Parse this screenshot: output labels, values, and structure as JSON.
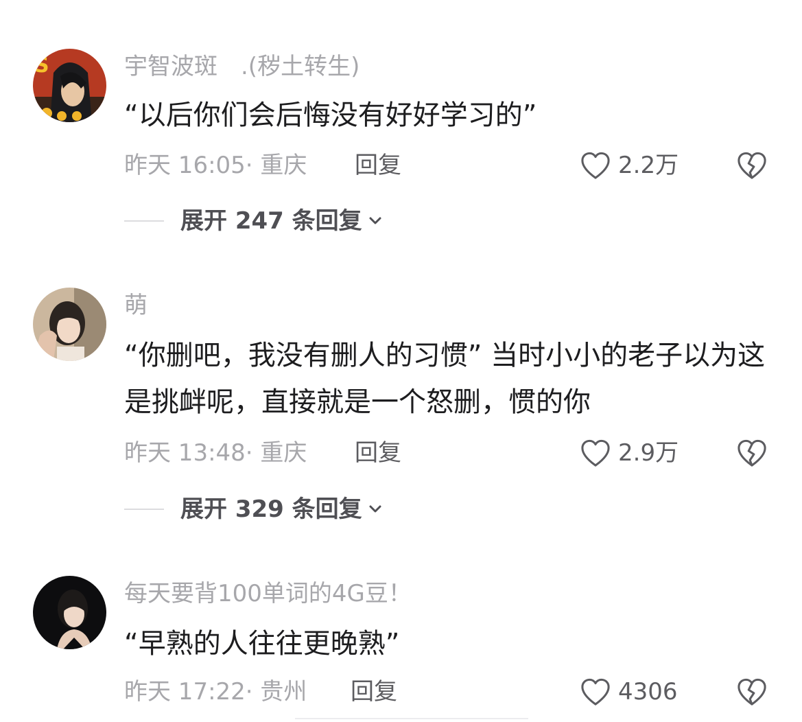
{
  "colors": {
    "username": "#a7a7ab",
    "text": "#1d1d1f",
    "meta": "#a7a7ab",
    "action": "#5c5c60",
    "expand": "#4f4f54"
  },
  "comments": [
    {
      "username": "宇智波斑　.(秽土转生)",
      "text": "“以后你们会后悔没有好好学习的”",
      "meta": "昨天 16:05· 重庆",
      "reply_label": "回复",
      "like_icon": "heart-outline-icon",
      "like_count": "2.2万",
      "dislike_icon": "broken-heart-icon",
      "expand_label": "展开 247 条回复",
      "expand_icon": "chevron-down-icon"
    },
    {
      "username": "萌",
      "text": "“你删吧，我没有删人的习惯” 当时小小的老子以为这是挑衅呢，直接就是一个怒删，惯的你",
      "meta": "昨天 13:48· 重庆",
      "reply_label": "回复",
      "like_icon": "heart-outline-icon",
      "like_count": "2.9万",
      "dislike_icon": "broken-heart-icon",
      "expand_label": "展开 329 条回复",
      "expand_icon": "chevron-down-icon"
    },
    {
      "username": "每天要背100单词的4G豆！",
      "text": "“早熟的人往往更晚熟”",
      "meta": "昨天 17:22· 贵州",
      "reply_label": "回复",
      "like_icon": "heart-outline-icon",
      "like_count": "4306",
      "dislike_icon": "broken-heart-icon"
    }
  ]
}
